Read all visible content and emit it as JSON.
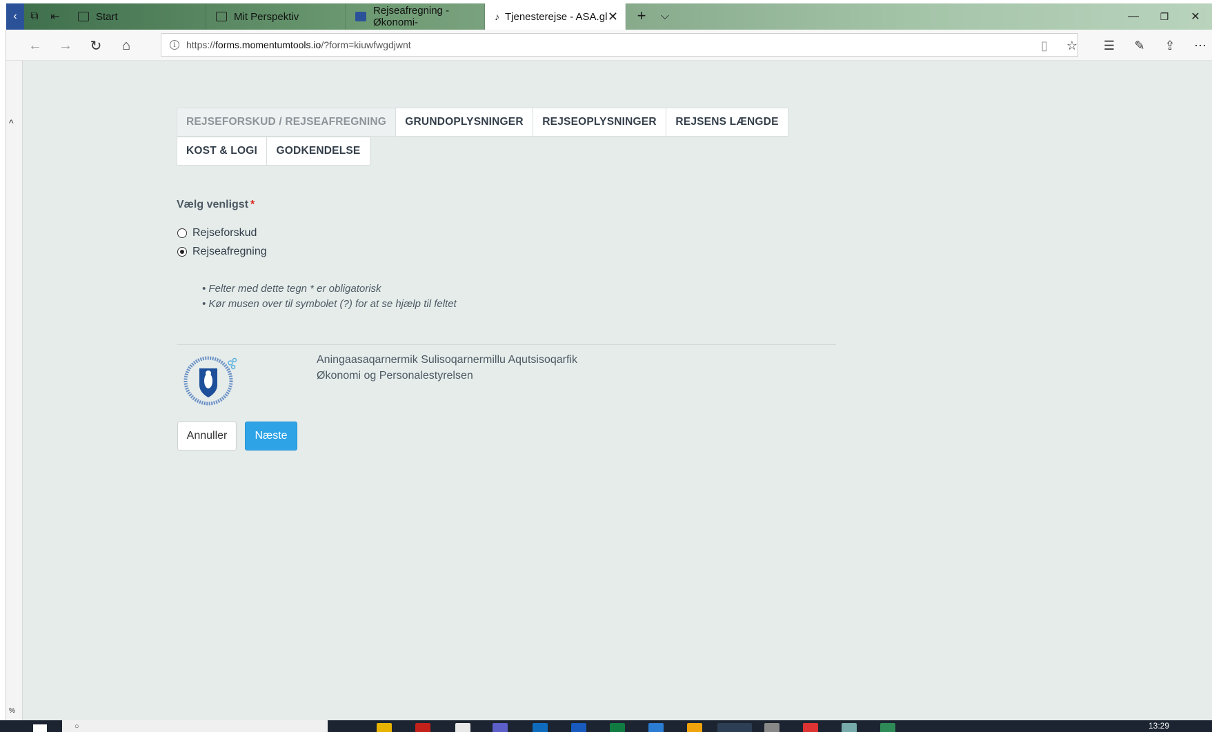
{
  "browser": {
    "tabs": [
      {
        "label": "Start"
      },
      {
        "label": "Mit Perspektiv"
      },
      {
        "label": "Rejseafregning - Økonomi-"
      },
      {
        "label": "Tjenesterejse - ASA.gl"
      }
    ],
    "url_prefix": "https://",
    "url_domain": "forms.momentumtools.io",
    "url_path": "/?form=kiuwfwgdjwnt"
  },
  "wizard": {
    "tabs": [
      {
        "label": "REJSEFORSKUD / REJSEAFREGNING",
        "active": true
      },
      {
        "label": "GRUNDOPLYSNINGER"
      },
      {
        "label": "REJSEOPLYSNINGER"
      },
      {
        "label": "REJSENS LÆNGDE"
      },
      {
        "label": "KOST & LOGI"
      },
      {
        "label": "GODKENDELSE"
      }
    ]
  },
  "form": {
    "label": "Vælg venligst",
    "required_mark": "*",
    "options": [
      {
        "label": "Rejseforskud",
        "selected": false
      },
      {
        "label": "Rejseafregning",
        "selected": true
      }
    ],
    "notes": [
      "• Felter med dette tegn * er obligatorisk",
      "• Kør musen over til symbolet (?) for at se hjælp til feltet"
    ]
  },
  "footer": {
    "org_line1": "Aningaasaqarnermik Sulisoqarnermillu Aqutsisoqarfik",
    "org_line2": "Økonomi og Personalestyrelsen"
  },
  "buttons": {
    "cancel": "Annuller",
    "next": "Næste"
  },
  "sidebar": {
    "zoom": "%"
  },
  "taskbar": {
    "clock": "13:29"
  },
  "colors": {
    "page_bg": "#e5ecea",
    "primary_button": "#2ea3e6",
    "required": "#d9261c"
  }
}
